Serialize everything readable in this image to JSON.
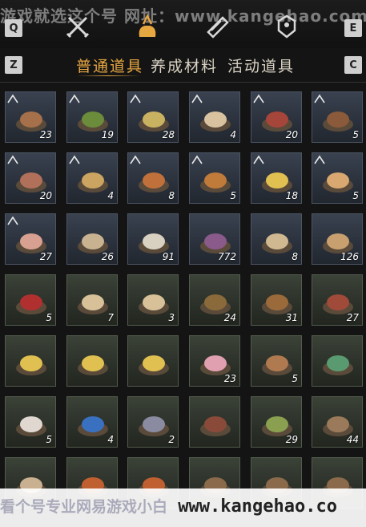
{
  "watermark_top": "游戏就选这个号  网址：www.kangehao.com",
  "watermark_bottom_cn": "看个号专业网易游戏小白",
  "watermark_bottom_url": "www.kangehao.co",
  "keys": {
    "left_top": "Q",
    "right_top": "E",
    "left_sub": "Z",
    "right_sub": "C"
  },
  "top_icons": [
    "crossed-swords-icon",
    "pouch-icon",
    "scroll-icon",
    "location-marker-icon"
  ],
  "tabs": [
    {
      "label": "普通道具",
      "active": true
    },
    {
      "label": "养成材料",
      "active": false
    },
    {
      "label": "活动道具",
      "active": false
    }
  ],
  "items": [
    {
      "name": "grilled-meat-dish",
      "qty": "23",
      "badge": true,
      "color": "#a5704a"
    },
    {
      "name": "green-gourd",
      "qty": "19",
      "badge": true,
      "color": "#6b8c3a"
    },
    {
      "name": "noodle-plate",
      "qty": "28",
      "badge": true,
      "color": "#c9b162"
    },
    {
      "name": "dumpling-plate",
      "qty": "4",
      "badge": true,
      "color": "#d8c2a0"
    },
    {
      "name": "braised-dish-bowl",
      "qty": "20",
      "badge": true,
      "color": "#a6453a"
    },
    {
      "name": "stew-pot",
      "qty": "5",
      "badge": true,
      "color": "#8a5a3a"
    },
    {
      "name": "sliced-meat-plate",
      "qty": "20",
      "badge": true,
      "color": "#b0705a"
    },
    {
      "name": "egg-bowl",
      "qty": "4",
      "badge": true,
      "color": "#caa460"
    },
    {
      "name": "meatball-plate",
      "qty": "8",
      "badge": true,
      "color": "#c0703a"
    },
    {
      "name": "fried-chicken-plate",
      "qty": "5",
      "badge": true,
      "color": "#c07a3a"
    },
    {
      "name": "scrambled-egg-plate",
      "qty": "18",
      "badge": true,
      "color": "#e0c050"
    },
    {
      "name": "pancake-stack",
      "qty": "5",
      "badge": true,
      "color": "#d8a870"
    },
    {
      "name": "peach-bun",
      "qty": "27",
      "badge": true,
      "color": "#d8a090"
    },
    {
      "name": "painting-scroll",
      "qty": "26",
      "badge": false,
      "color": "#c8b290"
    },
    {
      "name": "ceramic-jar",
      "qty": "91",
      "badge": false,
      "color": "#d8d0c0"
    },
    {
      "name": "silk-box",
      "qty": "772",
      "badge": false,
      "color": "#8a5a8a"
    },
    {
      "name": "paper-sheet",
      "qty": "8",
      "badge": false,
      "color": "#d0b890"
    },
    {
      "name": "horn",
      "qty": "126",
      "badge": false,
      "color": "#c8a070"
    },
    {
      "name": "red-envelope",
      "qty": "5",
      "badge": false,
      "color": "#b03030"
    },
    {
      "name": "scroll",
      "qty": "7",
      "badge": false,
      "color": "#d8c098"
    },
    {
      "name": "scroll",
      "qty": "3",
      "badge": false,
      "color": "#d8c098"
    },
    {
      "name": "herb-dish",
      "qty": "24",
      "badge": false,
      "color": "#8a6a3a"
    },
    {
      "name": "soup-pot",
      "qty": "31",
      "badge": false,
      "color": "#9a6a3a"
    },
    {
      "name": "spiced-bowl",
      "qty": "27",
      "badge": false,
      "color": "#a04a3a"
    },
    {
      "name": "gold-ingot-tray",
      "qty": "",
      "badge": false,
      "color": "#e0c050"
    },
    {
      "name": "gold-ingot-tray",
      "qty": "",
      "badge": false,
      "color": "#e0c050"
    },
    {
      "name": "gold-ingot-tray",
      "qty": "",
      "badge": false,
      "color": "#e0c050"
    },
    {
      "name": "plum-blossom",
      "qty": "23",
      "badge": false,
      "color": "#e0a0b0"
    },
    {
      "name": "flatbread",
      "qty": "5",
      "badge": false,
      "color": "#b07a50"
    },
    {
      "name": "jade-teapot",
      "qty": "",
      "badge": false,
      "color": "#5a9a70"
    },
    {
      "name": "silver-ingot-pile",
      "qty": "5",
      "badge": false,
      "color": "#e0d8d0"
    },
    {
      "name": "blue-pouch",
      "qty": "4",
      "badge": false,
      "color": "#3a70c0"
    },
    {
      "name": "staff",
      "qty": "2",
      "badge": false,
      "color": "#8a8aa0"
    },
    {
      "name": "lacquer-box",
      "qty": "",
      "badge": false,
      "color": "#8a4a3a"
    },
    {
      "name": "tea-leaves-tray",
      "qty": "29",
      "badge": false,
      "color": "#8aa050"
    },
    {
      "name": "rope-tray",
      "qty": "44",
      "badge": false,
      "color": "#9a7a5a"
    },
    {
      "name": "grain-sack",
      "qty": "",
      "badge": false,
      "color": "#c8b090"
    },
    {
      "name": "firework-stick",
      "qty": "",
      "badge": false,
      "color": "#c06030"
    },
    {
      "name": "firework-stick",
      "qty": "",
      "badge": false,
      "color": "#c06030"
    },
    {
      "name": "log-bundle",
      "qty": "",
      "badge": false,
      "color": "#8a6a4a"
    },
    {
      "name": "log-bundle",
      "qty": "",
      "badge": false,
      "color": "#8a6a4a"
    },
    {
      "name": "log-bundle",
      "qty": "",
      "badge": false,
      "color": "#8a6a4a"
    }
  ]
}
